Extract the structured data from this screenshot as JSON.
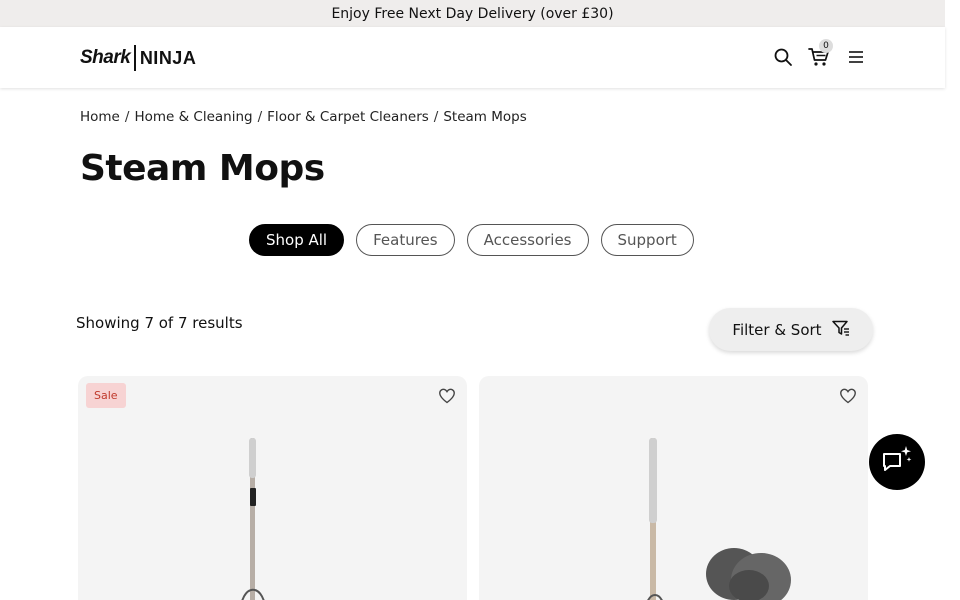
{
  "promo": {
    "text": "Enjoy Free Next Day Delivery (over £30)"
  },
  "header": {
    "logo_left": "Shark",
    "logo_right": "NINJA",
    "cart_count": "0",
    "icons": [
      "search-icon",
      "cart-icon",
      "menu-icon"
    ]
  },
  "breadcrumb": [
    {
      "label": "Home"
    },
    {
      "label": "Home & Cleaning"
    },
    {
      "label": "Floor & Carpet Cleaners"
    },
    {
      "label": "Steam Mops"
    }
  ],
  "breadcrumb_separator": "/",
  "page_title": "Steam Mops",
  "tabs": [
    {
      "label": "Shop All",
      "active": true
    },
    {
      "label": "Features",
      "active": false
    },
    {
      "label": "Accessories",
      "active": false
    },
    {
      "label": "Support",
      "active": false
    }
  ],
  "results_text": "Showing 7 of 7 results",
  "filter_sort": {
    "label": "Filter & Sort",
    "icon": "filter-icon"
  },
  "products": [
    {
      "badge": "Sale",
      "icon": "heart-icon"
    },
    {
      "badge": "",
      "icon": "heart-icon"
    }
  ],
  "chat": {
    "icon": "chat-sparkle-icon"
  },
  "colors": {
    "promo_bg": "#efedec",
    "active_tab_bg": "#000000",
    "sale_badge_bg": "#f7d3d3",
    "sale_badge_text": "#c0392b",
    "card_bg": "#f4f4f4"
  }
}
